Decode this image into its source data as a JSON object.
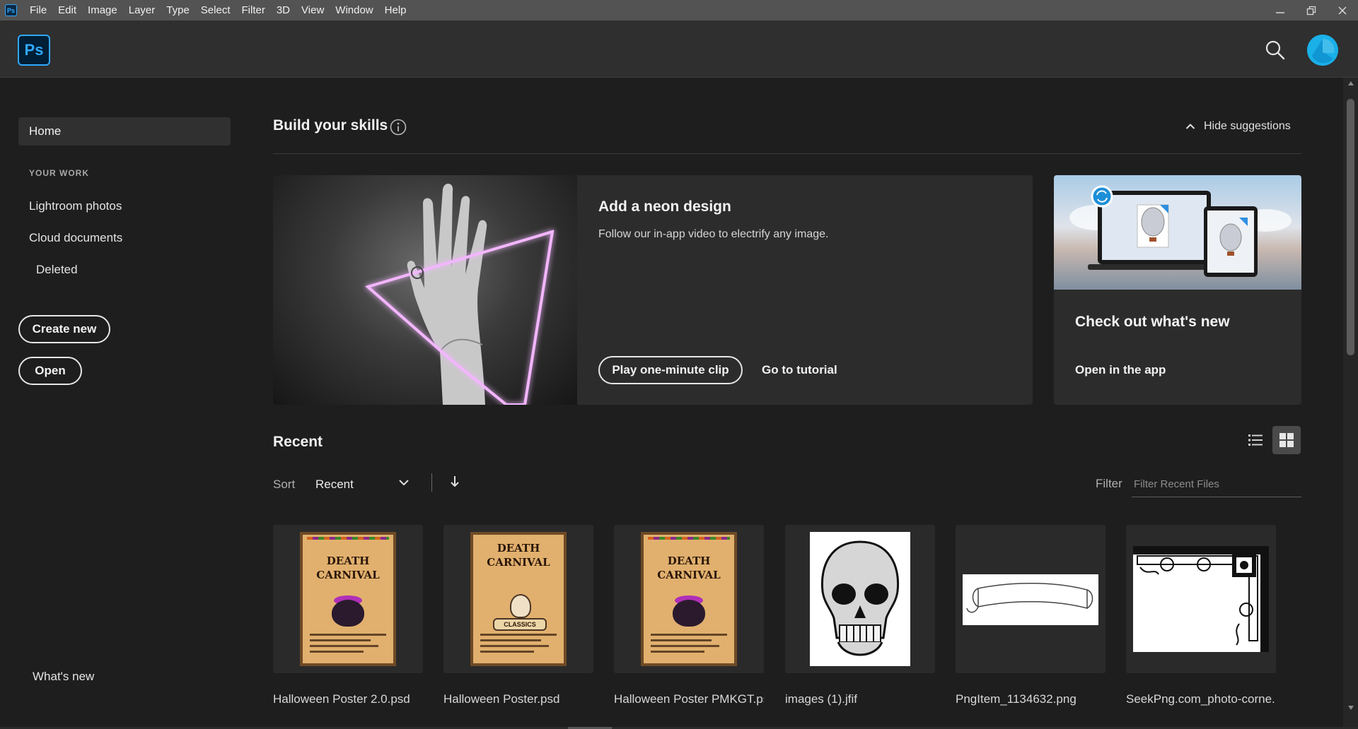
{
  "menubar": {
    "app_badge": "Ps",
    "items": [
      "File",
      "Edit",
      "Image",
      "Layer",
      "Type",
      "Select",
      "Filter",
      "3D",
      "View",
      "Window",
      "Help"
    ],
    "window_controls": [
      "minimize-icon",
      "restore-icon",
      "close-icon"
    ]
  },
  "header": {
    "logo_text": "Ps",
    "search_icon": "search-icon",
    "avatar_icon": "user-avatar",
    "accent_color": "#31a8ff"
  },
  "sidebar": {
    "home": "Home",
    "section_label": "YOUR WORK",
    "items": [
      "Lightroom photos",
      "Cloud documents",
      "Deleted"
    ],
    "create_new": "Create new",
    "open": "Open",
    "whats_new": "What's new"
  },
  "skills": {
    "title": "Build your skills",
    "hide_suggestions": "Hide suggestions",
    "neon_card": {
      "title": "Add a neon design",
      "description": "Follow our in-app video to electrify any image.",
      "play_button": "Play one-minute clip",
      "tutorial_link": "Go to tutorial"
    },
    "new_card": {
      "title": "Check out what's new",
      "link": "Open in the app"
    }
  },
  "recent": {
    "title": "Recent",
    "sort_label": "Sort",
    "sort_value": "Recent",
    "filter_label": "Filter",
    "filter_placeholder": "Filter Recent Files",
    "view_modes": [
      "list-view-icon",
      "grid-view-icon"
    ],
    "active_view": "grid",
    "files": [
      {
        "name": "Halloween Poster 2.0.psd",
        "thumb": "carnival-poster-cauldron"
      },
      {
        "name": "Halloween Poster.psd",
        "thumb": "carnival-poster-skull"
      },
      {
        "name": "Halloween Poster PMKGT.psd",
        "thumb": "carnival-poster-cauldron"
      },
      {
        "name": "images (1).jfif",
        "thumb": "skull-drawing"
      },
      {
        "name": "PngItem_1134632.png",
        "thumb": "banner-scroll"
      },
      {
        "name": "SeekPng.com_photo-corne...",
        "thumb": "ornate-corner"
      }
    ],
    "poster_text": {
      "death": "DEATH",
      "carnival": "CARNIVAL",
      "ribbon": "CLASSICS"
    }
  }
}
